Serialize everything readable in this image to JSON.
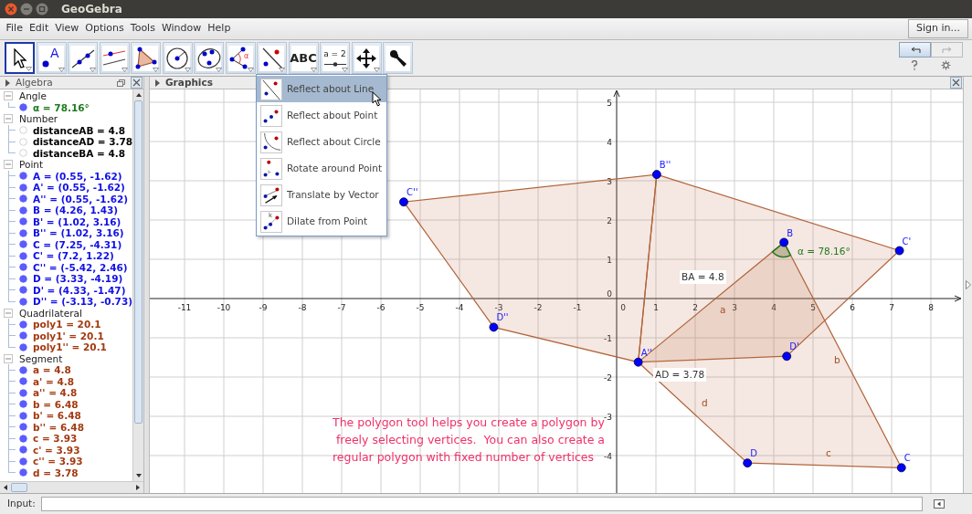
{
  "window": {
    "title": "GeoGebra"
  },
  "menu_bar": [
    "File",
    "Edit",
    "View",
    "Options",
    "Tools",
    "Window",
    "Help"
  ],
  "sign_in_button": "Sign in...",
  "toolbar": {
    "tools": [
      {
        "kind": "move",
        "selected": true,
        "menu": true
      },
      {
        "kind": "point",
        "text": "A",
        "selected": false,
        "menu": true
      },
      {
        "kind": "line",
        "selected": false,
        "menu": true
      },
      {
        "kind": "parallel",
        "selected": false,
        "menu": true
      },
      {
        "kind": "polygon",
        "selected": false,
        "menu": true
      },
      {
        "kind": "circle",
        "selected": false,
        "menu": true
      },
      {
        "kind": "conic",
        "selected": false,
        "menu": true
      },
      {
        "kind": "angle",
        "text": "α",
        "selected": false,
        "menu": true
      },
      {
        "kind": "reflect",
        "selected": false,
        "menu": true
      },
      {
        "kind": "text",
        "text": "ABC",
        "selected": false,
        "menu": true
      },
      {
        "kind": "slider",
        "text": "a = 2",
        "selected": false,
        "menu": true
      },
      {
        "kind": "pan",
        "selected": false,
        "menu": true
      },
      {
        "kind": "wrench",
        "selected": false,
        "menu": false
      }
    ]
  },
  "tool_menu": {
    "items": [
      {
        "kind": "line",
        "label": "Reflect about Line",
        "selected": true
      },
      {
        "kind": "point",
        "label": "Reflect about Point",
        "selected": false
      },
      {
        "kind": "circle",
        "label": "Reflect about Circle",
        "selected": false
      },
      {
        "kind": "rotate",
        "label": "Rotate around Point",
        "selected": false
      },
      {
        "kind": "vector",
        "label": "Translate by Vector",
        "selected": false
      },
      {
        "kind": "dilate",
        "label": "Dilate from Point",
        "icon_text": "k",
        "selected": false
      }
    ]
  },
  "algebra": {
    "title": "Algebra",
    "groups": [
      {
        "label": "Angle",
        "expanded": true,
        "children": [
          {
            "text": "α = 78.16°",
            "visible": true,
            "color": "#1e7b1e"
          }
        ]
      },
      {
        "label": "Number",
        "expanded": true,
        "children": [
          {
            "text": "distanceAB = 4.8",
            "visible": false,
            "color": "#000000"
          },
          {
            "text": "distanceAD = 3.78",
            "visible": false,
            "color": "#000000"
          },
          {
            "text": "distanceBA = 4.8",
            "visible": false,
            "color": "#000000"
          }
        ]
      },
      {
        "label": "Point",
        "expanded": true,
        "children": [
          {
            "text": "A = (0.55, -1.62)",
            "visible": true,
            "color": "#1010e8"
          },
          {
            "text": "A' = (0.55, -1.62)",
            "visible": true,
            "color": "#1010e8"
          },
          {
            "text": "A'' = (0.55, -1.62)",
            "visible": true,
            "color": "#1010e8"
          },
          {
            "text": "B = (4.26, 1.43)",
            "visible": true,
            "color": "#1010e8"
          },
          {
            "text": "B' = (1.02, 3.16)",
            "visible": true,
            "color": "#1010e8"
          },
          {
            "text": "B'' = (1.02, 3.16)",
            "visible": true,
            "color": "#1010e8"
          },
          {
            "text": "C = (7.25, -4.31)",
            "visible": true,
            "color": "#1010e8"
          },
          {
            "text": "C' = (7.2, 1.22)",
            "visible": true,
            "color": "#1010e8"
          },
          {
            "text": "C'' = (-5.42, 2.46)",
            "visible": true,
            "color": "#1010e8"
          },
          {
            "text": "D = (3.33, -4.19)",
            "visible": true,
            "color": "#1010e8"
          },
          {
            "text": "D' = (4.33, -1.47)",
            "visible": true,
            "color": "#1010e8"
          },
          {
            "text": "D'' = (-3.13, -0.73)",
            "visible": true,
            "color": "#1010e8"
          }
        ]
      },
      {
        "label": "Quadrilateral",
        "expanded": true,
        "children": [
          {
            "text": "poly1 = 20.1",
            "visible": true,
            "color": "#a33a10"
          },
          {
            "text": "poly1' = 20.1",
            "visible": true,
            "color": "#a33a10"
          },
          {
            "text": "poly1'' = 20.1",
            "visible": true,
            "color": "#a33a10"
          }
        ]
      },
      {
        "label": "Segment",
        "expanded": true,
        "children": [
          {
            "text": "a = 4.8",
            "visible": true,
            "color": "#a33a10"
          },
          {
            "text": "a' = 4.8",
            "visible": true,
            "color": "#a33a10"
          },
          {
            "text": "a'' = 4.8",
            "visible": true,
            "color": "#a33a10"
          },
          {
            "text": "b = 6.48",
            "visible": true,
            "color": "#a33a10"
          },
          {
            "text": "b' = 6.48",
            "visible": true,
            "color": "#a33a10"
          },
          {
            "text": "b'' = 6.48",
            "visible": true,
            "color": "#a33a10"
          },
          {
            "text": "c = 3.93",
            "visible": true,
            "color": "#a33a10"
          },
          {
            "text": "c' = 3.93",
            "visible": true,
            "color": "#a33a10"
          },
          {
            "text": "c'' = 3.93",
            "visible": true,
            "color": "#a33a10"
          },
          {
            "text": "d = 3.78",
            "visible": true,
            "color": "#a33a10"
          }
        ]
      }
    ]
  },
  "graphics": {
    "title": "Graphics",
    "x_ticks": [
      "-11",
      "-10",
      "-9",
      "-8",
      "-7",
      "-6",
      "-5",
      "-4",
      "-3",
      "-2",
      "-1",
      "0",
      "1",
      "2",
      "3",
      "4",
      "5",
      "6",
      "7",
      "8"
    ],
    "y_ticks": [
      "5",
      "4",
      "3",
      "2",
      "1",
      "0",
      "-1",
      "-2",
      "-3",
      "-4"
    ],
    "points": [
      "C''",
      "B''",
      "B",
      "C'",
      "D''",
      "A''",
      "D'",
      "D",
      "C"
    ],
    "segment_labels": [
      "a",
      "b",
      "c",
      "d"
    ],
    "measures": [
      "BA = 4.8",
      "AD = 3.78"
    ],
    "angle_label": "α = 78.16°",
    "note_lines": [
      "The polygon tool helps you create a polygon by",
      " freely selecting vertices.  You can also create a",
      "regular polygon with fixed number of vertices"
    ]
  },
  "input_bar": {
    "label": "Input:"
  }
}
